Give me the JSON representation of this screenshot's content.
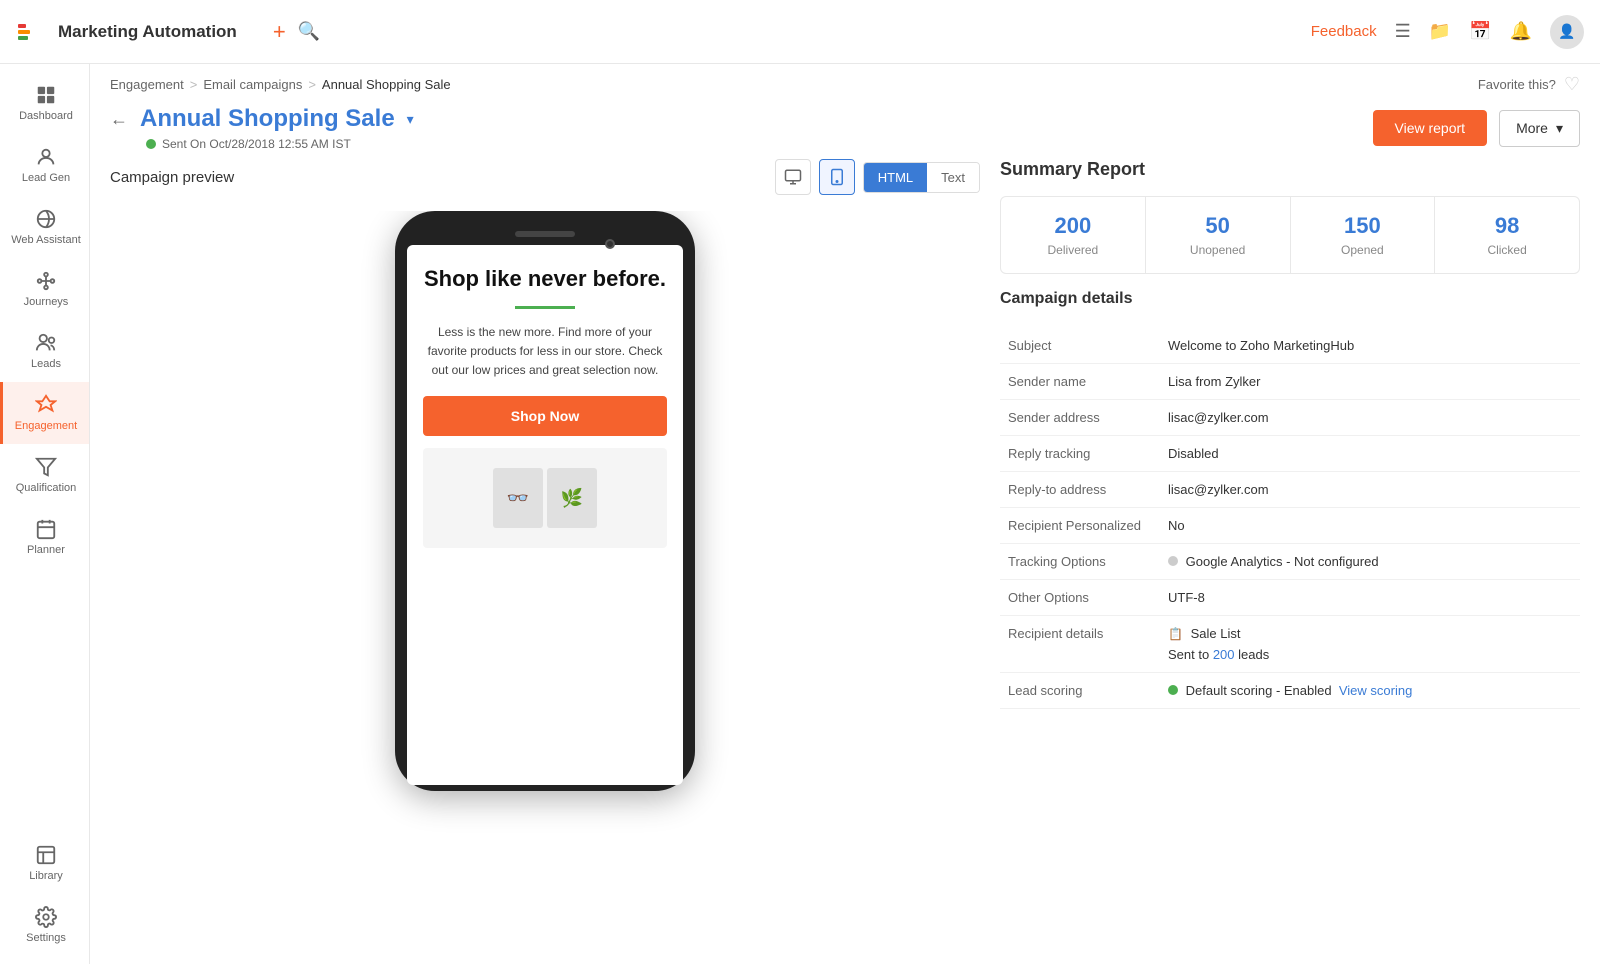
{
  "topbar": {
    "title": "Marketing Automation",
    "plus_label": "+",
    "feedback_label": "Feedback"
  },
  "breadcrumb": {
    "part1": "Engagement",
    "part2": "Email campaigns",
    "part3": "Annual Shopping Sale",
    "favorite_label": "Favorite this?",
    "sep": ">"
  },
  "page_header": {
    "title": "Annual Shopping Sale",
    "status": "Sent On Oct/28/2018 12:55 AM IST",
    "view_report_label": "View report",
    "more_label": "More"
  },
  "preview": {
    "title": "Campaign preview",
    "desktop_icon": "🖥",
    "mobile_icon": "📱",
    "html_label": "HTML",
    "text_label": "Text",
    "email": {
      "headline": "Shop like never before.",
      "body": "Less is the new more. Find more of your favorite products for less in our store. Check out our low prices and great selection now.",
      "cta": "Shop Now"
    }
  },
  "summary": {
    "title": "Summary Report",
    "stats": [
      {
        "value": "200",
        "label": "Delivered"
      },
      {
        "value": "50",
        "label": "Unopened"
      },
      {
        "value": "150",
        "label": "Opened"
      },
      {
        "value": "98",
        "label": "Clicked"
      }
    ],
    "details_title": "Campaign details",
    "details": [
      {
        "label": "Subject",
        "value": "Welcome to Zoho MarketingHub"
      },
      {
        "label": "Sender name",
        "value": "Lisa from Zylker"
      },
      {
        "label": "Sender address",
        "value": "lisac@zylker.com"
      },
      {
        "label": "Reply tracking",
        "value": "Disabled"
      },
      {
        "label": "Reply-to address",
        "value": "lisac@zylker.com"
      },
      {
        "label": "Recipient Personalized",
        "value": "No"
      },
      {
        "label": "Tracking Options",
        "value": "Google Analytics - Not configured"
      },
      {
        "label": "Other Options",
        "value": "UTF-8"
      },
      {
        "label": "Recipient details",
        "value": "Sale List",
        "sub": "Sent to 200 leads"
      },
      {
        "label": "Lead scoring",
        "value": "Default scoring - Enabled",
        "link": "View scoring"
      }
    ]
  },
  "sidebar": {
    "items": [
      {
        "id": "dashboard",
        "label": "Dashboard",
        "active": false
      },
      {
        "id": "lead-gen",
        "label": "Lead Gen",
        "active": false
      },
      {
        "id": "web-assistant",
        "label": "Web Assistant",
        "active": false
      },
      {
        "id": "journeys",
        "label": "Journeys",
        "active": false
      },
      {
        "id": "leads",
        "label": "Leads",
        "active": false
      },
      {
        "id": "engagement",
        "label": "Engagement",
        "active": true
      },
      {
        "id": "qualification",
        "label": "Qualification",
        "active": false
      },
      {
        "id": "planner",
        "label": "Planner",
        "active": false
      },
      {
        "id": "library",
        "label": "Library",
        "active": false
      },
      {
        "id": "settings",
        "label": "Settings",
        "active": false
      }
    ]
  }
}
